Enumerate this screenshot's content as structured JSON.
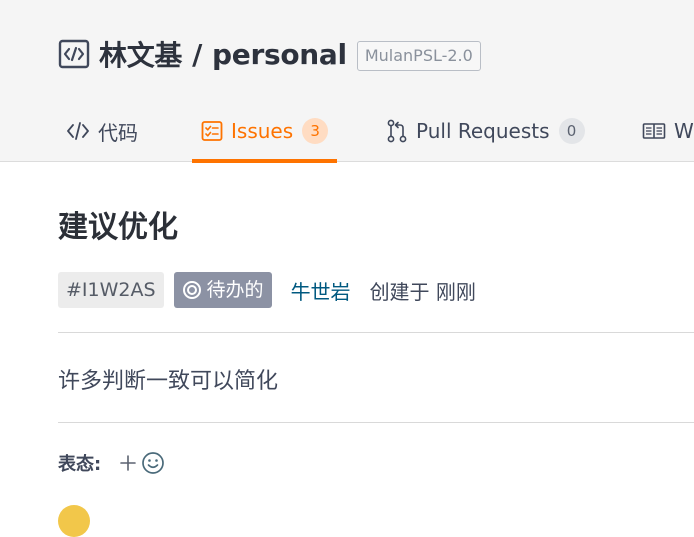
{
  "repo": {
    "owner": "林文基",
    "separator": "/",
    "name": "personal",
    "license": "MulanPSL-2.0",
    "icon": "code-repo-icon"
  },
  "tabs": [
    {
      "label": "代码",
      "icon": "code-icon",
      "active": false
    },
    {
      "label": "Issues",
      "icon": "issues-icon",
      "count": "3",
      "active": true
    },
    {
      "label": "Pull Requests",
      "icon": "pull-request-icon",
      "count": "0",
      "active": false
    },
    {
      "label": "W",
      "icon": "wiki-icon",
      "active": false
    }
  ],
  "issue": {
    "title": "建议优化",
    "id": "#I1W2AS",
    "state": "待办的",
    "state_icon": "todo-circle-icon",
    "author": "牛世岩",
    "created": "创建于 刚刚",
    "body": "许多判断一致可以简化"
  },
  "reactions": {
    "label": "表态:",
    "add_icon": "plus-icon",
    "emoji_icon": "smiley-icon"
  },
  "colors": {
    "accent": "#fe7300",
    "state_badge": "#8c92a4",
    "author_link": "#005980"
  }
}
